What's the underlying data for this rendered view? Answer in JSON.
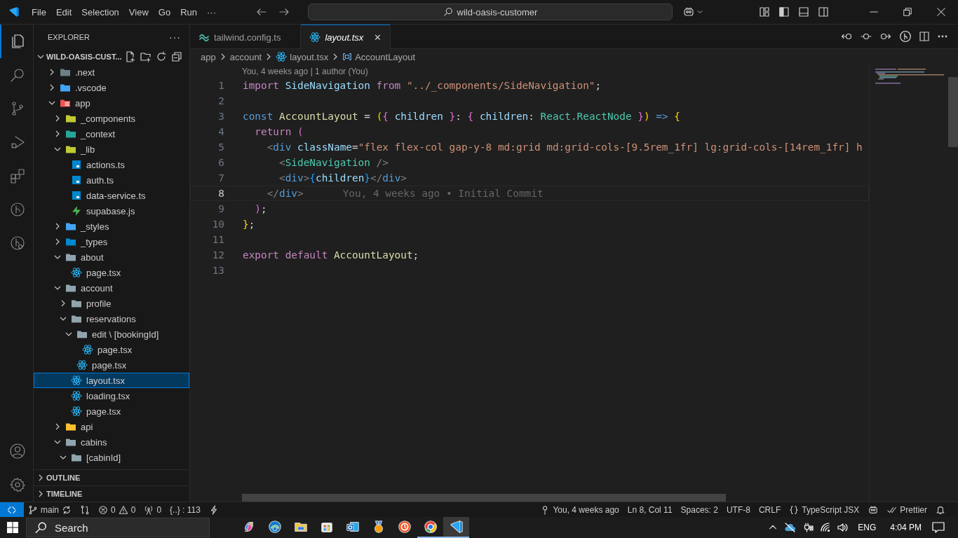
{
  "title_bar": {
    "menu": [
      "File",
      "Edit",
      "Selection",
      "View",
      "Go",
      "Run",
      "···"
    ],
    "command_center": "wild-oasis-customer"
  },
  "activity_bar": [
    {
      "kind": "explorer",
      "selected": true
    },
    {
      "kind": "search",
      "selected": false
    },
    {
      "kind": "source-control",
      "selected": false
    },
    {
      "kind": "run",
      "selected": false
    },
    {
      "kind": "extensions",
      "selected": false
    },
    {
      "kind": "graph",
      "selected": false
    },
    {
      "kind": "history",
      "selected": false
    }
  ],
  "explorer": {
    "title": "EXPLORER",
    "more": "···",
    "root": {
      "label": "WILD-OASIS-CUST...",
      "expanded": true
    },
    "items": [
      {
        "label": ".next",
        "kind": "next",
        "expanded": false,
        "selected": false
      },
      {
        "label": ".vscode",
        "kind": "vscode",
        "expanded": false,
        "selected": false
      },
      {
        "label": "app",
        "kind": "app",
        "expanded": true,
        "selected": false,
        "children": [
          {
            "label": "_components",
            "kind": "components",
            "expanded": false,
            "selected": false
          },
          {
            "label": "_context",
            "kind": "context",
            "expanded": false,
            "selected": false
          },
          {
            "label": "_lib",
            "kind": "lib",
            "expanded": true,
            "selected": false,
            "children": [
              {
                "label": "actions.ts",
                "kind": "ts",
                "selected": false
              },
              {
                "label": "auth.ts",
                "kind": "ts",
                "selected": false
              },
              {
                "label": "data-service.ts",
                "kind": "ts",
                "selected": false
              },
              {
                "label": "supabase.js",
                "kind": "supabase",
                "selected": false
              }
            ]
          },
          {
            "label": "_styles",
            "kind": "styles",
            "expanded": false,
            "selected": false
          },
          {
            "label": "_types",
            "kind": "types",
            "expanded": false,
            "selected": false
          },
          {
            "label": "about",
            "kind": "folder",
            "expanded": true,
            "selected": false,
            "children": [
              {
                "label": "page.tsx",
                "kind": "react",
                "selected": false
              }
            ]
          },
          {
            "label": "account",
            "kind": "folder",
            "expanded": true,
            "selected": false,
            "children": [
              {
                "label": "profile",
                "kind": "folder",
                "expanded": false,
                "selected": false
              },
              {
                "label": "reservations",
                "kind": "folder",
                "expanded": true,
                "selected": false,
                "children": [
                  {
                    "label": "edit \\ [bookingId]",
                    "kind": "folder",
                    "expanded": true,
                    "selected": false,
                    "children": [
                      {
                        "label": "page.tsx",
                        "kind": "react",
                        "selected": false
                      }
                    ]
                  },
                  {
                    "label": "page.tsx",
                    "kind": "react",
                    "selected": false
                  }
                ]
              },
              {
                "label": "layout.tsx",
                "kind": "react",
                "selected": true
              },
              {
                "label": "loading.tsx",
                "kind": "react",
                "selected": false
              },
              {
                "label": "page.tsx",
                "kind": "react",
                "selected": false
              }
            ]
          },
          {
            "label": "api",
            "kind": "api",
            "expanded": false,
            "selected": false
          },
          {
            "label": "cabins",
            "kind": "folder",
            "expanded": true,
            "selected": false,
            "children": [
              {
                "label": "[cabinId]",
                "kind": "folder",
                "expanded": true,
                "selected": false
              }
            ]
          }
        ]
      }
    ],
    "sections": [
      {
        "label": "OUTLINE",
        "expanded": false
      },
      {
        "label": "TIMELINE",
        "expanded": false
      }
    ]
  },
  "tabs": [
    {
      "label": "tailwind.config.ts",
      "kind": "tailwind",
      "selected": false,
      "preview": false
    },
    {
      "label": "layout.tsx",
      "kind": "react",
      "selected": true,
      "preview": true,
      "close": "✕"
    }
  ],
  "breadcrumbs": [
    {
      "label": "app",
      "kind": "folder"
    },
    {
      "label": "account",
      "kind": "folder"
    },
    {
      "label": "layout.tsx",
      "kind": "react"
    },
    {
      "label": "AccountLayout",
      "kind": "symbol"
    }
  ],
  "editor": {
    "codelens": "You, 4 weeks ago | 1 author (You)",
    "lines": [
      {
        "number": "1",
        "current": false,
        "tokens": [
          {
            "text": "import",
            "kind": "kw"
          },
          {
            "text": " SideNavigation ",
            "kind": "var"
          },
          {
            "text": "from",
            "kind": "kw"
          },
          {
            "text": " \"../_components/SideNavigation\"",
            "kind": "str"
          },
          {
            "text": ";",
            "kind": "plain"
          }
        ]
      },
      {
        "number": "2",
        "current": false
      },
      {
        "number": "3",
        "current": false,
        "tokens": [
          {
            "text": "const",
            "kind": "storage"
          },
          {
            "text": " AccountLayout ",
            "kind": "fn"
          },
          {
            "text": "= ",
            "kind": "plain"
          },
          {
            "text": "(",
            "kind": "b1"
          },
          {
            "text": "{",
            "kind": "b2"
          },
          {
            "text": " children ",
            "kind": "var"
          },
          {
            "text": "}",
            "kind": "b2"
          },
          {
            "text": ": ",
            "kind": "plain"
          },
          {
            "text": "{",
            "kind": "b2"
          },
          {
            "text": " children",
            "kind": "var"
          },
          {
            "text": ": ",
            "kind": "plain"
          },
          {
            "text": "React.ReactNode ",
            "kind": "type"
          },
          {
            "text": "}",
            "kind": "b2"
          },
          {
            "text": ")",
            "kind": "b1"
          },
          {
            "text": " => ",
            "kind": "storage"
          },
          {
            "text": "{",
            "kind": "b1"
          }
        ]
      },
      {
        "number": "4",
        "current": false,
        "tokens": [
          {
            "text": "  return",
            "kind": "kw"
          },
          {
            "text": " (",
            "kind": "b2"
          }
        ]
      },
      {
        "number": "5",
        "current": false,
        "tokens": [
          {
            "text": "    <",
            "kind": "angle"
          },
          {
            "text": "div",
            "kind": "tag"
          },
          {
            "text": " className",
            "kind": "var"
          },
          {
            "text": "=",
            "kind": "plain"
          },
          {
            "text": "\"flex flex-col gap-y-8 md:grid md:grid-cols-[9.5rem_1fr] lg:grid-cols-[14rem_1fr] h",
            "kind": "str"
          }
        ]
      },
      {
        "number": "6",
        "current": false,
        "tokens": [
          {
            "text": "      <",
            "kind": "angle"
          },
          {
            "text": "SideNavigation",
            "kind": "type"
          },
          {
            "text": " />",
            "kind": "angle"
          }
        ]
      },
      {
        "number": "7",
        "current": false,
        "tokens": [
          {
            "text": "      <",
            "kind": "angle"
          },
          {
            "text": "div",
            "kind": "tag"
          },
          {
            "text": ">",
            "kind": "angle"
          },
          {
            "text": "{",
            "kind": "b3"
          },
          {
            "text": "children",
            "kind": "var"
          },
          {
            "text": "}",
            "kind": "b3"
          },
          {
            "text": "</",
            "kind": "angle"
          },
          {
            "text": "div",
            "kind": "tag"
          },
          {
            "text": ">",
            "kind": "angle"
          }
        ]
      },
      {
        "number": "8",
        "current": true,
        "blame": "You, 4 weeks ago • Initial Commit",
        "tokens": [
          {
            "text": "    </",
            "kind": "angle"
          },
          {
            "text": "div",
            "kind": "tag"
          },
          {
            "text": ">",
            "kind": "angle"
          }
        ]
      },
      {
        "number": "9",
        "current": false,
        "tokens": [
          {
            "text": "  )",
            "kind": "b2"
          },
          {
            "text": ";",
            "kind": "plain"
          }
        ]
      },
      {
        "number": "10",
        "current": false,
        "tokens": [
          {
            "text": "}",
            "kind": "b1"
          },
          {
            "text": ";",
            "kind": "plain"
          }
        ]
      },
      {
        "number": "11",
        "current": false
      },
      {
        "number": "12",
        "current": false,
        "tokens": [
          {
            "text": "export default",
            "kind": "kw"
          },
          {
            "text": " AccountLayout",
            "kind": "fn"
          },
          {
            "text": ";",
            "kind": "plain"
          }
        ]
      },
      {
        "number": "13",
        "current": false
      }
    ]
  },
  "status_bar": {
    "left": [
      {
        "kind": "remote"
      },
      {
        "kind": "branch",
        "text": "main"
      },
      {
        "kind": "compare"
      },
      {
        "kind": "problems",
        "errors": "0",
        "warnings": "0"
      },
      {
        "kind": "ports",
        "text": "0"
      },
      {
        "kind": "text",
        "text": "{..} : 113"
      },
      {
        "kind": "bolt"
      }
    ],
    "right": [
      {
        "kind": "blame",
        "text": "You, 4 weeks ago"
      },
      {
        "kind": "text",
        "text": "Ln 8, Col 11"
      },
      {
        "kind": "text",
        "text": "Spaces: 2"
      },
      {
        "kind": "text",
        "text": "UTF-8"
      },
      {
        "kind": "text",
        "text": "CRLF"
      },
      {
        "kind": "language",
        "text": "TypeScript JSX"
      },
      {
        "kind": "copilot"
      },
      {
        "kind": "prettier",
        "text": "Prettier"
      },
      {
        "kind": "bell"
      }
    ]
  },
  "taskbar": {
    "search": {
      "placeholder": "Search"
    },
    "apps": [
      {
        "kind": "copilot",
        "running": false,
        "selected": false
      },
      {
        "kind": "edge",
        "running": false,
        "selected": false
      },
      {
        "kind": "files",
        "running": false,
        "selected": false
      },
      {
        "kind": "store",
        "running": false,
        "selected": false
      },
      {
        "kind": "outlook",
        "running": false,
        "selected": false
      },
      {
        "kind": "medal",
        "running": false,
        "selected": false
      },
      {
        "kind": "clock",
        "running": false,
        "selected": false
      },
      {
        "kind": "chrome",
        "running": true,
        "selected": false
      },
      {
        "kind": "vscode",
        "running": true,
        "selected": true
      }
    ],
    "language": "ENG",
    "time": "4:04 PM"
  }
}
